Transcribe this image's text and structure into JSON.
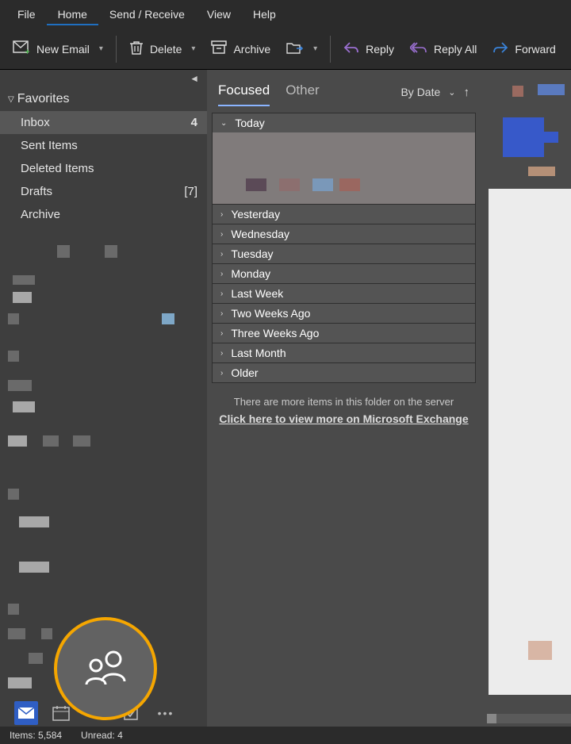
{
  "menu": {
    "file": "File",
    "home": "Home",
    "sendreceive": "Send / Receive",
    "view": "View",
    "help": "Help"
  },
  "ribbon": {
    "new_email": "New Email",
    "delete": "Delete",
    "archive": "Archive",
    "reply": "Reply",
    "reply_all": "Reply All",
    "forward": "Forward"
  },
  "favorites": {
    "header": "Favorites",
    "items": [
      {
        "label": "Inbox",
        "count": "4",
        "selected": true
      },
      {
        "label": "Sent Items",
        "count": ""
      },
      {
        "label": "Deleted Items",
        "count": ""
      },
      {
        "label": "Drafts",
        "count": "[7]"
      },
      {
        "label": "Archive",
        "count": ""
      }
    ]
  },
  "message_pane": {
    "tabs": {
      "focused": "Focused",
      "other": "Other"
    },
    "sort_label": "By Date",
    "groups": [
      "Today",
      "Yesterday",
      "Wednesday",
      "Tuesday",
      "Monday",
      "Last Week",
      "Two Weeks Ago",
      "Three Weeks Ago",
      "Last Month",
      "Older"
    ],
    "more_items_text": "There are more items in this folder on the server",
    "more_link_text": "Click here to view more on Microsoft Exchange"
  },
  "statusbar": {
    "items": "Items: 5,584",
    "unread": "Unread: 4"
  }
}
